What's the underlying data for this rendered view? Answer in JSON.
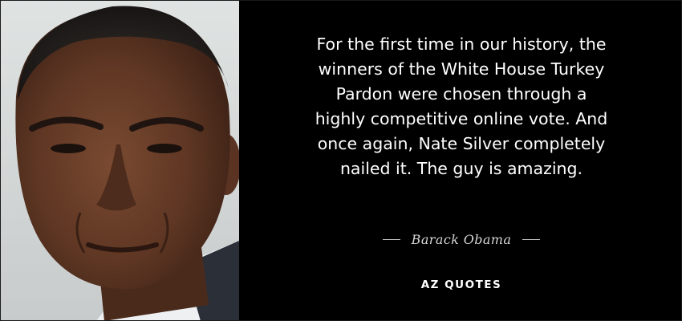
{
  "quote": {
    "lines": [
      "For the first time in our history, the",
      "winners of the White House Turkey",
      "Pardon were chosen through a",
      "highly competitive online vote. And",
      "once again, Nate Silver completely",
      "nailed it. The guy is amazing."
    ]
  },
  "author": {
    "name": "Barack Obama"
  },
  "brand": {
    "label": "AZ QUOTES"
  },
  "colors": {
    "background": "#000000",
    "text": "#ffffff",
    "rule": "#bfbfbf"
  }
}
